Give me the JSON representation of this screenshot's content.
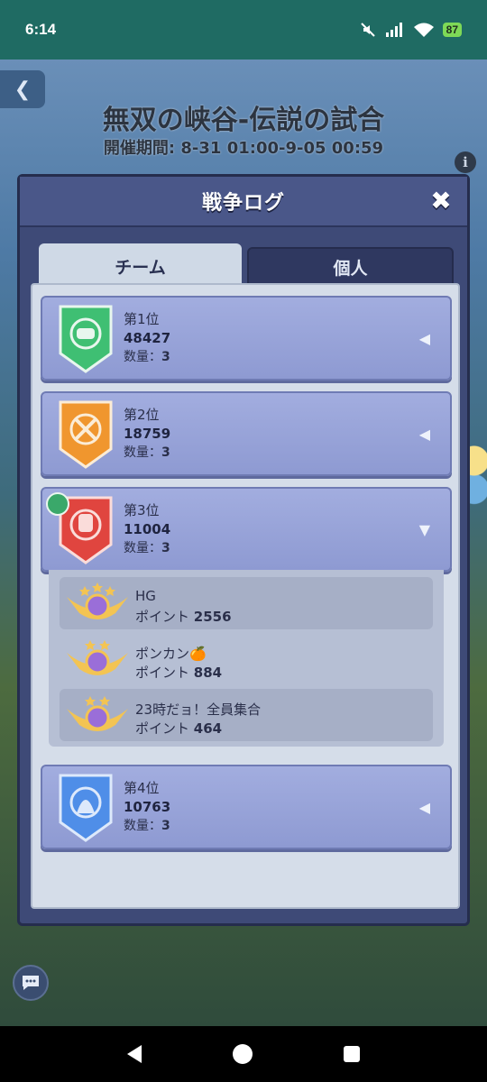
{
  "status_bar": {
    "time": "6:14",
    "battery": "87"
  },
  "event": {
    "title": "無双の峡谷-伝説の試合",
    "period": "開催期間: 8-31 01:00-9-05 00:59"
  },
  "modal": {
    "title": "戦争ログ",
    "tabs": [
      {
        "label": "チーム",
        "active": true
      },
      {
        "label": "個人",
        "active": false
      }
    ],
    "ranks": [
      {
        "rank_label": "第1位",
        "score": "48427",
        "count_label": "数量：",
        "count": "3",
        "color": "#3fbf73",
        "expanded": false
      },
      {
        "rank_label": "第2位",
        "score": "18759",
        "count_label": "数量：",
        "count": "3",
        "color": "#f0962e",
        "expanded": false
      },
      {
        "rank_label": "第3位",
        "score": "11004",
        "count_label": "数量：",
        "count": "3",
        "color": "#e0453f",
        "expanded": true
      },
      {
        "rank_label": "第4位",
        "score": "10763",
        "count_label": "数量：",
        "count": "3",
        "color": "#4f8ee8",
        "expanded": false
      }
    ],
    "members": [
      {
        "name": "HG",
        "points_label": "ポイント",
        "points": "2556"
      },
      {
        "name": "ポンカン🍊",
        "points_label": "ポイント",
        "points": "884"
      },
      {
        "name": "23時だョ！全員集合",
        "points_label": "ポイント",
        "points": "464"
      }
    ]
  }
}
